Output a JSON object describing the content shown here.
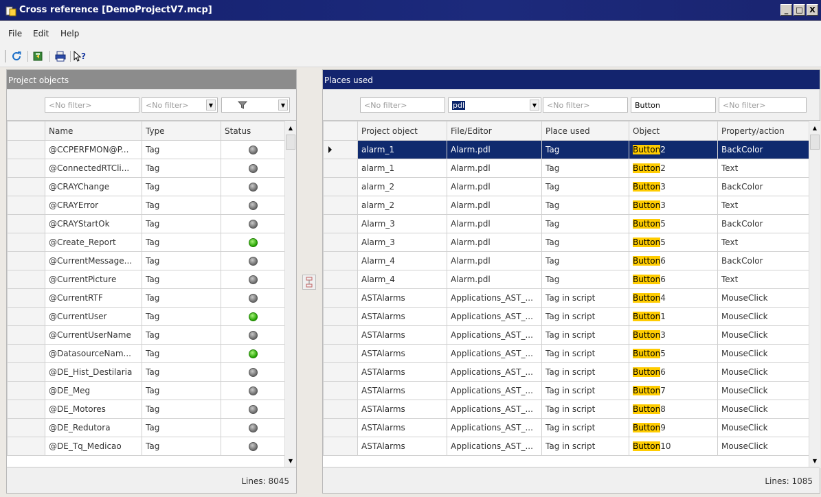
{
  "window": {
    "title": "Cross reference [DemoProjectV7.mcp]",
    "buttons": [
      "_",
      "□",
      "X"
    ]
  },
  "menu": [
    "File",
    "Edit",
    "Help"
  ],
  "toolbar": [
    "refresh-icon",
    "export-icon",
    "print-icon",
    "help-icon"
  ],
  "left_pane": {
    "title": "Project objects",
    "filters": {
      "name": "<No filter>",
      "type": "<No filter>",
      "status_icon": "filter-icon"
    },
    "columns": [
      "Name",
      "Type",
      "Status"
    ],
    "rows": [
      {
        "name": "@CCPERFMON@P...",
        "type": "Tag",
        "status": "grey"
      },
      {
        "name": "@ConnectedRTCli...",
        "type": "Tag",
        "status": "grey"
      },
      {
        "name": "@CRAYChange",
        "type": "Tag",
        "status": "grey"
      },
      {
        "name": "@CRAYError",
        "type": "Tag",
        "status": "grey"
      },
      {
        "name": "@CRAYStartOk",
        "type": "Tag",
        "status": "grey"
      },
      {
        "name": "@Create_Report",
        "type": "Tag",
        "status": "green"
      },
      {
        "name": "@CurrentMessage...",
        "type": "Tag",
        "status": "grey"
      },
      {
        "name": "@CurrentPicture",
        "type": "Tag",
        "status": "grey"
      },
      {
        "name": "@CurrentRTF",
        "type": "Tag",
        "status": "grey"
      },
      {
        "name": "@CurrentUser",
        "type": "Tag",
        "status": "green"
      },
      {
        "name": "@CurrentUserName",
        "type": "Tag",
        "status": "grey"
      },
      {
        "name": "@DatasourceNam...",
        "type": "Tag",
        "status": "green"
      },
      {
        "name": "@DE_Hist_Destilaria",
        "type": "Tag",
        "status": "grey"
      },
      {
        "name": "@DE_Meg",
        "type": "Tag",
        "status": "grey"
      },
      {
        "name": "@DE_Motores",
        "type": "Tag",
        "status": "grey"
      },
      {
        "name": "@DE_Redutora",
        "type": "Tag",
        "status": "grey"
      },
      {
        "name": "@DE_Tq_Medicao",
        "type": "Tag",
        "status": "grey"
      }
    ],
    "lines_label": "Lines: 8045"
  },
  "right_pane": {
    "title": "Places used",
    "filters": {
      "project_object": "<No filter>",
      "file_editor": "pdl",
      "place_used": "<No filter>",
      "object": "Button",
      "property_action": "<No filter>"
    },
    "columns": [
      "Project object",
      "File/Editor",
      "Place used",
      "Object",
      "Property/action"
    ],
    "rows": [
      {
        "project_object": "alarm_1",
        "file": "Alarm.pdl",
        "place": "Tag",
        "object_hl": "Button",
        "object_rest": "2",
        "property": "BackColor"
      },
      {
        "project_object": "alarm_1",
        "file": "Alarm.pdl",
        "place": "Tag",
        "object_hl": "Button",
        "object_rest": "2",
        "property": "Text"
      },
      {
        "project_object": "alarm_2",
        "file": "Alarm.pdl",
        "place": "Tag",
        "object_hl": "Button",
        "object_rest": "3",
        "property": "BackColor"
      },
      {
        "project_object": "alarm_2",
        "file": "Alarm.pdl",
        "place": "Tag",
        "object_hl": "Button",
        "object_rest": "3",
        "property": "Text"
      },
      {
        "project_object": "Alarm_3",
        "file": "Alarm.pdl",
        "place": "Tag",
        "object_hl": "Button",
        "object_rest": "5",
        "property": "BackColor"
      },
      {
        "project_object": "Alarm_3",
        "file": "Alarm.pdl",
        "place": "Tag",
        "object_hl": "Button",
        "object_rest": "5",
        "property": "Text"
      },
      {
        "project_object": "Alarm_4",
        "file": "Alarm.pdl",
        "place": "Tag",
        "object_hl": "Button",
        "object_rest": "6",
        "property": "BackColor"
      },
      {
        "project_object": "Alarm_4",
        "file": "Alarm.pdl",
        "place": "Tag",
        "object_hl": "Button",
        "object_rest": "6",
        "property": "Text"
      },
      {
        "project_object": "ASTAlarms",
        "file": "Applications_AST_...",
        "place": "Tag in script",
        "object_hl": "Button",
        "object_rest": "4",
        "property": "MouseClick"
      },
      {
        "project_object": "ASTAlarms",
        "file": "Applications_AST_...",
        "place": "Tag in script",
        "object_hl": "Button",
        "object_rest": "1",
        "property": "MouseClick"
      },
      {
        "project_object": "ASTAlarms",
        "file": "Applications_AST_...",
        "place": "Tag in script",
        "object_hl": "Button",
        "object_rest": "3",
        "property": "MouseClick"
      },
      {
        "project_object": "ASTAlarms",
        "file": "Applications_AST_...",
        "place": "Tag in script",
        "object_hl": "Button",
        "object_rest": "5",
        "property": "MouseClick"
      },
      {
        "project_object": "ASTAlarms",
        "file": "Applications_AST_...",
        "place": "Tag in script",
        "object_hl": "Button",
        "object_rest": "6",
        "property": "MouseClick"
      },
      {
        "project_object": "ASTAlarms",
        "file": "Applications_AST_...",
        "place": "Tag in script",
        "object_hl": "Button",
        "object_rest": "7",
        "property": "MouseClick"
      },
      {
        "project_object": "ASTAlarms",
        "file": "Applications_AST_...",
        "place": "Tag in script",
        "object_hl": "Button",
        "object_rest": "8",
        "property": "MouseClick"
      },
      {
        "project_object": "ASTAlarms",
        "file": "Applications_AST_...",
        "place": "Tag in script",
        "object_hl": "Button",
        "object_rest": "9",
        "property": "MouseClick"
      },
      {
        "project_object": "ASTAlarms",
        "file": "Applications_AST_...",
        "place": "Tag in script",
        "object_hl": "Button",
        "object_rest": "10",
        "property": "MouseClick"
      }
    ],
    "active_row": 0,
    "lines_label": "Lines: 1085"
  },
  "colors": {
    "title_bar": "#1c2a7c",
    "right_header": "#13246e",
    "left_header": "#8c8c8c",
    "selection": "#0f2a6e",
    "highlight": "#ffcc00",
    "status_green": "#23a300",
    "status_grey": "#6a6a6a"
  }
}
